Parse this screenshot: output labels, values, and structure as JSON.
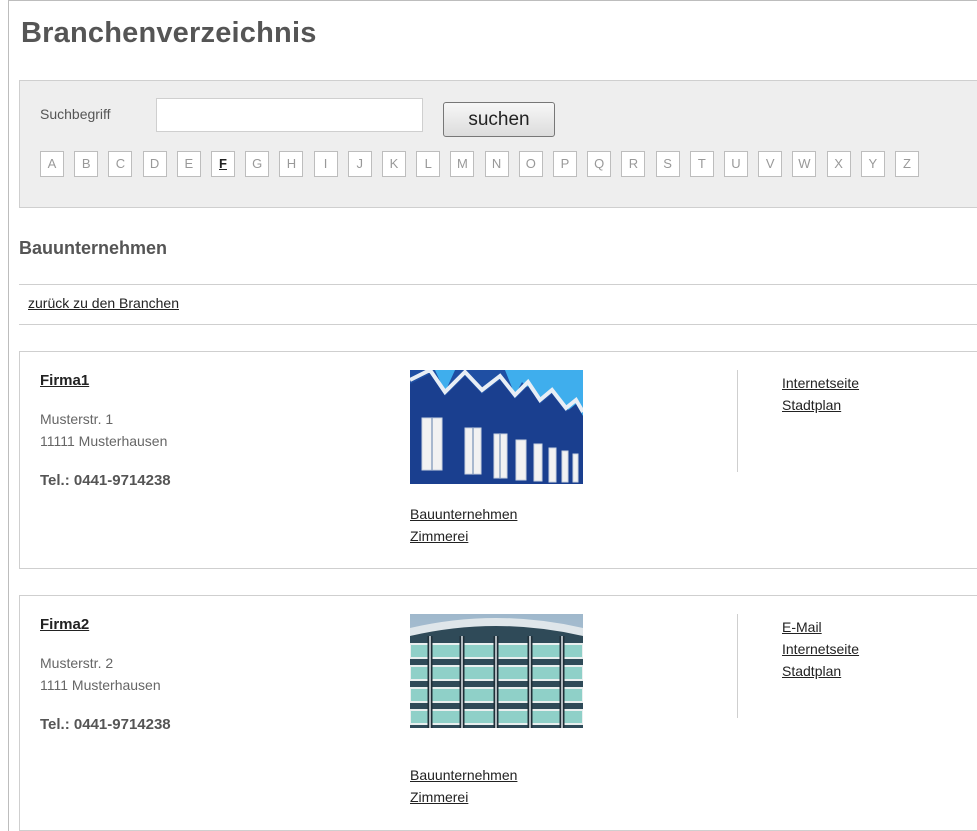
{
  "page": {
    "title": "Branchenverzeichnis"
  },
  "search": {
    "label": "Suchbegriff",
    "value": "",
    "placeholder": "",
    "button_label": "suchen",
    "letters": [
      "A",
      "B",
      "C",
      "D",
      "E",
      "F",
      "G",
      "H",
      "I",
      "J",
      "K",
      "L",
      "M",
      "N",
      "O",
      "P",
      "Q",
      "R",
      "S",
      "T",
      "U",
      "V",
      "W",
      "X",
      "Y",
      "Z"
    ],
    "active_letter": "F"
  },
  "category": {
    "heading": "Bauunternehmen",
    "back_link": "zurück zu den Branchen"
  },
  "companies": [
    {
      "name": "Firma1",
      "street": "Musterstr. 1",
      "city": "11111 Musterhausen",
      "phone": "Tel.: 0441-9714238",
      "categories": [
        "Bauunternehmen",
        "Zimmerei"
      ],
      "links": [
        "Internetseite",
        "Stadtplan"
      ],
      "photo": "blue-wooden-houses-photo"
    },
    {
      "name": "Firma2",
      "street": "Musterstr. 2",
      "city": "1111 Musterhausen",
      "phone": "Tel.: 0441-9714238",
      "categories": [
        "Bauunternehmen",
        "Zimmerei"
      ],
      "links": [
        "E-Mail",
        "Internetseite",
        "Stadtplan"
      ],
      "photo": "glass-office-building-photo"
    }
  ],
  "colors": {
    "panel_bg": "#eeeeee",
    "border": "#cfcfcf",
    "heading": "#555555",
    "link": "#222222"
  }
}
